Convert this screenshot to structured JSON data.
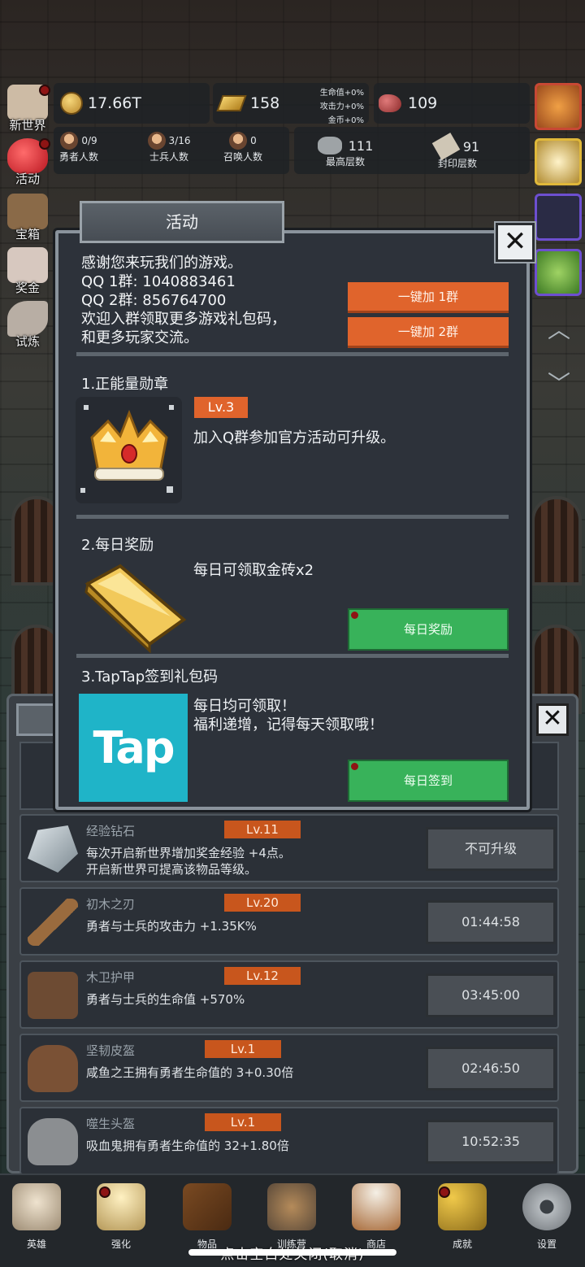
{
  "top_stats": {
    "gold": "17.66T",
    "gold_bars": "158",
    "bonus_hp": "生命值+0%",
    "bonus_atk": "攻击力+0%",
    "bonus_coin": "金币+0%",
    "meat": "109"
  },
  "people": [
    {
      "value": "0/9",
      "label": "勇者人数"
    },
    {
      "value": "3/16",
      "label": "士兵人数"
    },
    {
      "value": "0",
      "label": "召唤人数"
    }
  ],
  "floors": [
    {
      "value": "111",
      "label": "最高层数"
    },
    {
      "value": "91",
      "label": "封印层数"
    }
  ],
  "side_menu": [
    {
      "label": "新世界",
      "icon": "world-map-icon"
    },
    {
      "label": "活动",
      "icon": "heart-icon"
    },
    {
      "label": "宝箱",
      "icon": "chest-icon"
    },
    {
      "label": "奖金",
      "icon": "money-bag-icon"
    },
    {
      "label": "试炼",
      "icon": "feather-icon"
    }
  ],
  "right_icons": [
    "onion-icon",
    "candle-icon",
    "backpack-icon",
    "slime-icon"
  ],
  "modal": {
    "title": "活动",
    "intro_line1": "感谢您来玩我们的游戏。",
    "intro_line2": "QQ 1群: 1040883461",
    "intro_line3": "QQ 2群: 856764700",
    "intro_line4": "欢迎入群领取更多游戏礼包码，",
    "intro_line5": "和更多玩家交流。",
    "join_group1": "一键加 1群",
    "join_group2": "一键加 2群",
    "section1_title": "1.正能量勋章",
    "section1_level": "Lv.3",
    "section1_desc": "加入Q群参加官方活动可升级。",
    "section2_title": "2.每日奖励",
    "section2_desc": "每日可领取金砖x2",
    "section2_button": "每日奖励",
    "section3_title": "3.TapTap签到礼包码",
    "section3_desc1": "每日均可领取！",
    "section3_desc2": "福利递增，记得每天领取哦！",
    "section3_button": "每日签到",
    "tap_logo_text": "Tap"
  },
  "items": [
    {
      "name": "经验钻石",
      "level": "Lv.11",
      "desc1": "每次开启新世界增加奖金经验 +4点。",
      "desc2": "开启新世界可提高该物品等级。",
      "button": "不可升级"
    },
    {
      "name": "初木之刃",
      "level": "Lv.20",
      "desc1": "勇者与士兵的攻击力 +1.35K%",
      "desc2": "",
      "button": "01:44:58"
    },
    {
      "name": "木卫护甲",
      "level": "Lv.12",
      "desc1": "勇者与士兵的生命值 +570%",
      "desc2": "",
      "button": "03:45:00"
    },
    {
      "name": "坚韧皮盔",
      "level": "Lv.1",
      "desc1": "咸鱼之王拥有勇者生命值的 3+0.30倍",
      "desc2": "",
      "button": "02:46:50"
    },
    {
      "name": "噬生头盔",
      "level": "Lv.1",
      "desc1": "吸血鬼拥有勇者生命值的 32+1.80倍",
      "desc2": "",
      "button": "10:52:35"
    }
  ],
  "bottom_nav": [
    {
      "label": "英雄",
      "icon": "skull-icon"
    },
    {
      "label": "强化",
      "icon": "candle-icon"
    },
    {
      "label": "物品",
      "icon": "book-icon"
    },
    {
      "label": "训练营",
      "icon": "lantern-icon"
    },
    {
      "label": "商店",
      "icon": "beer-mug-icon"
    },
    {
      "label": "成就",
      "icon": "key-icon"
    },
    {
      "label": "设置",
      "icon": "gear-icon"
    }
  ],
  "hint": "点击空白处关闭(取消)"
}
